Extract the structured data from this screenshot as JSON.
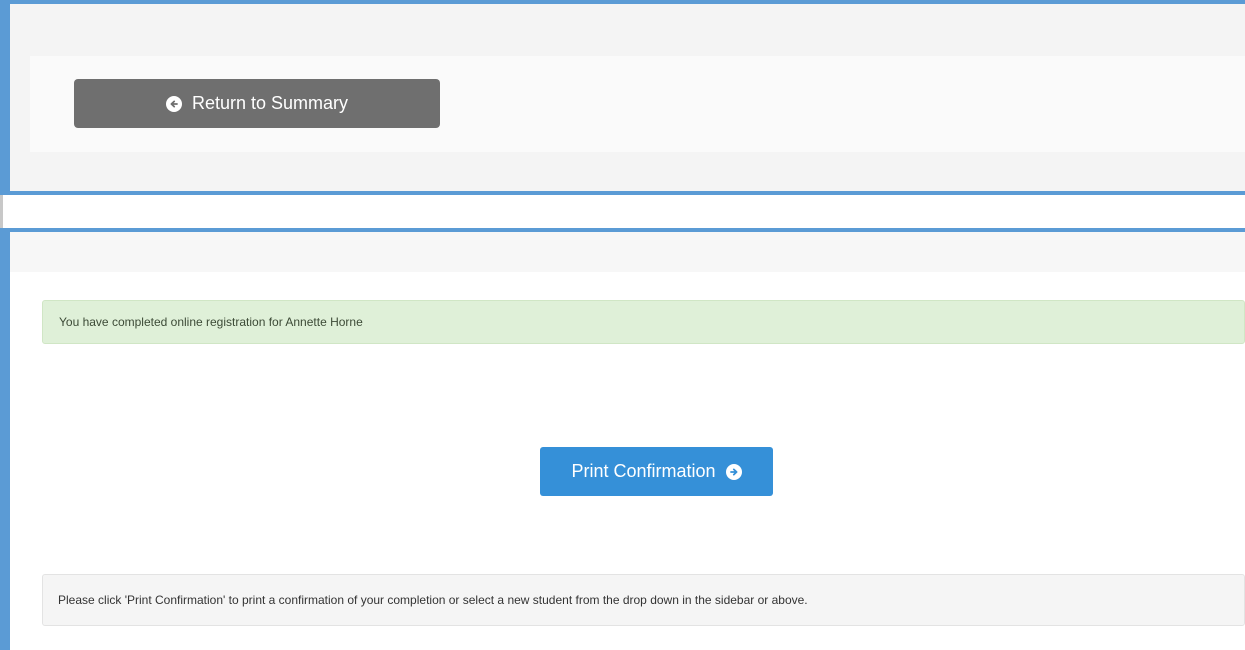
{
  "return_button": {
    "label": "Return to Summary",
    "icon": "arrow-circle-left-icon"
  },
  "success_alert": {
    "text": "You have completed online registration for Annette Horne"
  },
  "print_button": {
    "label": "Print Confirmation",
    "icon": "arrow-circle-right-icon"
  },
  "info_note": {
    "text": "Please click 'Print Confirmation' to print a confirmation of your completion or select a new student from the drop down in the sidebar or above."
  },
  "colors": {
    "panel_border": "#5b9bd5",
    "return_button_bg": "#6f6f6f",
    "print_button_bg": "#3590d8",
    "success_bg": "#dff0d8",
    "note_bg": "#f5f5f5"
  }
}
